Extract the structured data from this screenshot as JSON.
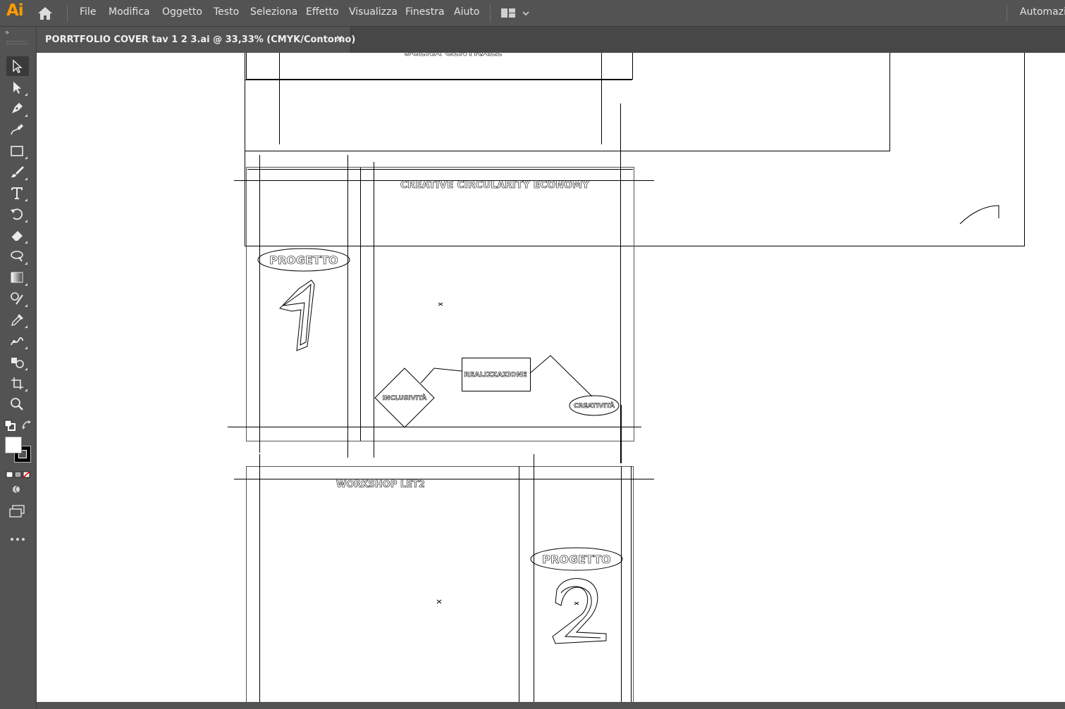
{
  "app": {
    "logo": "Ai",
    "automation_label": "Automazi"
  },
  "menu": [
    "File",
    "Modifica",
    "Oggetto",
    "Testo",
    "Seleziona",
    "Effetto",
    "Visualizza",
    "Finestra",
    "Aiuto"
  ],
  "document_tab": {
    "title": "PORRTFOLIO COVER tav 1 2 3.ai @ 33,33% (CMYK/Contorno)",
    "close": "×"
  },
  "tools": [
    "selection-tool",
    "direct-selection-tool",
    "pen-tool",
    "curvature-tool",
    "rectangle-tool",
    "paintbrush-tool",
    "type-tool",
    "rotate-tool",
    "eraser-tool",
    "lasso-tool",
    "gradient-tool",
    "shape-builder-tool",
    "eyedropper-tool",
    "puppet-warp-tool",
    "symbol-sprayer-tool",
    "artboard-tool",
    "zoom-tool"
  ],
  "artwork": {
    "top_partial_text": "SCENA CENTRALE",
    "title_1": "CREATIVE CIRCULARITY ECONOMY",
    "progetto_1": "PROGETTO",
    "number_1": "1",
    "node_realizzazione": "REALIZZAZIONE",
    "node_inclusivita": "INCLUSIVITÀ",
    "node_creativita": "CREATIVITÀ",
    "title_2": "WORKSHOP LET2",
    "progetto_2": "PROGETTO",
    "number_2": "2"
  }
}
